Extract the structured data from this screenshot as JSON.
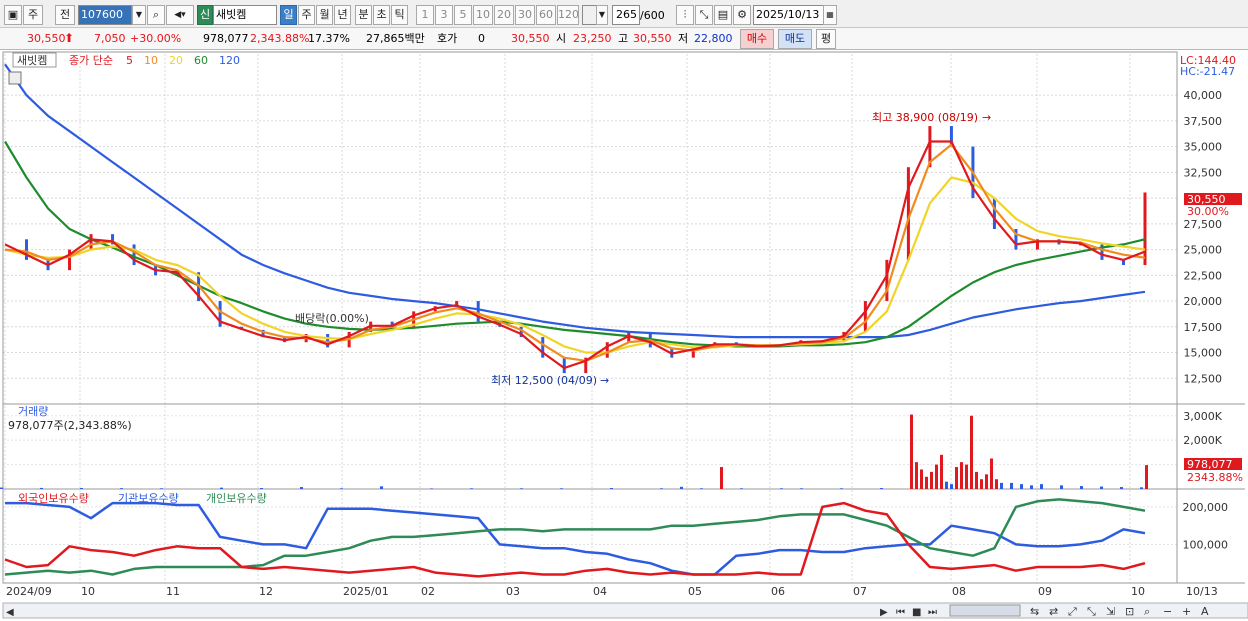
{
  "toolbar": {
    "tab_day": "주",
    "tab_prev": "전",
    "code": "107600",
    "stock_badge": "신",
    "name": "새빗켐",
    "periods": [
      "일",
      "주",
      "월",
      "년",
      "분",
      "초",
      "틱"
    ],
    "nums": [
      "1",
      "3",
      "5",
      "10",
      "20",
      "30",
      "60",
      "120"
    ],
    "count": "265",
    "count_total": "/600",
    "date": "2025/10/13"
  },
  "quote": {
    "price": "30,550",
    "change": "7,050",
    "rate": "+30.00%",
    "volume": "978,077",
    "vol_ratio": "2,343.88%",
    "turnover": "17.37%",
    "amount": "27,865백만",
    "hoga_label": "호가",
    "hoga": "0",
    "hoga_price": "30,550",
    "open_label": "시",
    "open": "23,250",
    "high_label": "고",
    "high": "30,550",
    "low_label": "저",
    "low": "22,800",
    "buy": "매수",
    "sell": "매도",
    "eval": "평"
  },
  "legend": {
    "name": "새빗켐",
    "ma_label": "종가 단순",
    "ma_periods": [
      "5",
      "10",
      "20",
      "60",
      "120"
    ],
    "ma_colors": [
      "#e0191f",
      "#f08c1e",
      "#f0d528",
      "#1e8c2d",
      "#2e5ce0"
    ]
  },
  "annotations": {
    "high": "최고 38,900 (08/19)",
    "low": "최저 12,500 (04/09)",
    "dividend": "배당락(0.00%)"
  },
  "scale": {
    "lc": "LC:144.40",
    "hc": "HC:-21.47",
    "price_tag": "30,550",
    "pct_tag": "30.00%",
    "vol_tag": "978,077",
    "vol_pct": "2343.88%"
  },
  "volume_panel": {
    "title": "거래량",
    "value": "978,077주(2,343.88%)"
  },
  "holding_panel": {
    "foreign": "외국인보유수량",
    "inst": "기관보유수량",
    "indiv": "개인보유수량",
    "colors": [
      "#e0191f",
      "#2e5ce0",
      "#2e8b57"
    ]
  },
  "chart_data": {
    "type": "line",
    "price_axis": {
      "min": 10000,
      "max": 45000,
      "ticks": [
        "12,500",
        "15,000",
        "17,500",
        "20,000",
        "22,500",
        "25,000",
        "27,500",
        "30,000",
        "32,500",
        "35,000",
        "37,500",
        "40,000"
      ]
    },
    "volume_axis": {
      "ticks": [
        "1,000K",
        "2,000K",
        "3,000K"
      ]
    },
    "holding_axis": {
      "ticks": [
        "100,000",
        "200,000"
      ]
    },
    "months": [
      "2024/09",
      "10",
      "11",
      "12",
      "2025/01",
      "02",
      "03",
      "04",
      "05",
      "06",
      "07",
      "08",
      "09",
      "10",
      "10/13"
    ],
    "x_index": [
      0,
      5,
      10,
      15,
      20,
      25,
      30,
      35,
      40,
      45,
      50,
      55,
      60,
      65,
      70,
      75,
      80,
      85,
      90,
      95,
      100,
      105,
      110,
      115,
      120,
      125,
      130,
      135,
      140,
      145,
      150,
      155,
      160,
      165,
      170,
      175,
      180,
      185,
      190,
      195,
      200,
      205,
      210,
      215,
      220,
      225,
      230,
      235,
      240,
      245,
      250,
      255,
      260,
      265
    ],
    "close": [
      26000,
      24000,
      23000,
      25000,
      26500,
      25500,
      23500,
      22500,
      22800,
      20000,
      17500,
      17200,
      16500,
      16000,
      16800,
      15500,
      17000,
      18000,
      17500,
      19000,
      19500,
      20000,
      18000,
      17500,
      16500,
      14500,
      13000,
      14500,
      16000,
      17000,
      15500,
      14500,
      15500,
      16000,
      15800,
      15500,
      15800,
      16200,
      16000,
      17000,
      20000,
      24000,
      33000,
      37000,
      35000,
      30000,
      27000,
      25000,
      26000,
      25500,
      25500,
      24000,
      23500,
      30550
    ],
    "ma5": [
      25500,
      24500,
      23500,
      24500,
      26000,
      25800,
      24000,
      23000,
      22800,
      20500,
      18000,
      17300,
      16600,
      16200,
      16500,
      15800,
      16600,
      17600,
      17600,
      18600,
      19300,
      19600,
      18500,
      17700,
      16800,
      15000,
      13500,
      14200,
      15600,
      16600,
      16000,
      14900,
      15300,
      15800,
      15800,
      15600,
      15700,
      16000,
      16100,
      16600,
      19000,
      22500,
      31000,
      35500,
      35500,
      31000,
      28000,
      25500,
      25800,
      25800,
      25600,
      24500,
      24000,
      24800
    ],
    "ma10": [
      25000,
      24800,
      24000,
      24300,
      25500,
      25800,
      24800,
      23500,
      23000,
      21500,
      19000,
      17800,
      17000,
      16500,
      16400,
      16000,
      16300,
      17200,
      17500,
      18200,
      18900,
      19300,
      18800,
      18000,
      17200,
      15800,
      14500,
      14200,
      15000,
      16000,
      16200,
      15400,
      15200,
      15600,
      15800,
      15700,
      15700,
      15900,
      16000,
      16400,
      18000,
      21000,
      28000,
      33500,
      35200,
      32500,
      29000,
      26500,
      25800,
      25800,
      25700,
      25000,
      24500,
      24200
    ],
    "ma20": [
      25000,
      24500,
      24200,
      24300,
      25000,
      25300,
      25000,
      24000,
      23500,
      22500,
      20500,
      18800,
      17800,
      17000,
      16600,
      16400,
      16300,
      16800,
      17200,
      17700,
      18300,
      18800,
      18700,
      18300,
      17700,
      16700,
      15600,
      15000,
      15000,
      15600,
      16000,
      15800,
      15500,
      15500,
      15700,
      15700,
      15700,
      15800,
      15900,
      16100,
      17000,
      19000,
      24000,
      29500,
      32000,
      31500,
      30000,
      28000,
      26800,
      26300,
      26000,
      25600,
      25300,
      25000
    ],
    "ma60": [
      35500,
      32000,
      29000,
      27000,
      26000,
      25200,
      24300,
      23500,
      22500,
      21500,
      20500,
      19800,
      19000,
      18300,
      17800,
      17500,
      17300,
      17200,
      17300,
      17400,
      17600,
      17800,
      17900,
      18000,
      17800,
      17500,
      17200,
      17000,
      16800,
      16600,
      16300,
      16000,
      15800,
      15700,
      15600,
      15600,
      15600,
      15700,
      15700,
      15800,
      16000,
      16500,
      17500,
      19000,
      20500,
      21800,
      22800,
      23500,
      24000,
      24400,
      24800,
      25200,
      25500,
      26000
    ],
    "ma120": [
      43000,
      40000,
      38000,
      36500,
      35000,
      33500,
      32000,
      30500,
      29000,
      27500,
      26000,
      24500,
      23500,
      22700,
      22000,
      21300,
      20800,
      20500,
      20200,
      20000,
      19800,
      19500,
      19200,
      18800,
      18400,
      18000,
      17700,
      17400,
      17200,
      17000,
      16900,
      16800,
      16700,
      16600,
      16500,
      16500,
      16500,
      16500,
      16500,
      16500,
      16500,
      16500,
      16700,
      17200,
      17800,
      18400,
      18800,
      19200,
      19500,
      19800,
      20000,
      20300,
      20600,
      20900
    ],
    "volume_k": [
      [
        0,
        60
      ],
      [
        40,
        45
      ],
      [
        80,
        40
      ],
      [
        120,
        35
      ],
      [
        160,
        30
      ],
      [
        220,
        55
      ],
      [
        260,
        40
      ],
      [
        300,
        80
      ],
      [
        340,
        30
      ],
      [
        380,
        110
      ],
      [
        430,
        25
      ],
      [
        470,
        30
      ],
      [
        520,
        30
      ],
      [
        560,
        30
      ],
      [
        610,
        40
      ],
      [
        660,
        30
      ],
      [
        680,
        90
      ],
      [
        700,
        30
      ],
      [
        720,
        900
      ],
      [
        740,
        30
      ],
      [
        780,
        30
      ],
      [
        800,
        30
      ],
      [
        840,
        30
      ],
      [
        880,
        40
      ],
      [
        910,
        3050
      ],
      [
        915,
        1100
      ],
      [
        920,
        800
      ],
      [
        925,
        500
      ],
      [
        930,
        700
      ],
      [
        935,
        1000
      ],
      [
        940,
        1400
      ],
      [
        945,
        300
      ],
      [
        950,
        200
      ],
      [
        955,
        900
      ],
      [
        960,
        1100
      ],
      [
        965,
        1000
      ],
      [
        970,
        3000
      ],
      [
        975,
        700
      ],
      [
        980,
        400
      ],
      [
        985,
        600
      ],
      [
        990,
        1250
      ],
      [
        995,
        400
      ],
      [
        1000,
        250
      ],
      [
        1010,
        250
      ],
      [
        1020,
        200
      ],
      [
        1030,
        150
      ],
      [
        1040,
        200
      ],
      [
        1060,
        150
      ],
      [
        1080,
        120
      ],
      [
        1100,
        100
      ],
      [
        1120,
        80
      ],
      [
        1140,
        70
      ],
      [
        1145,
        978
      ]
    ],
    "foreign": [
      60000,
      40000,
      45000,
      95000,
      85000,
      80000,
      70000,
      85000,
      95000,
      90000,
      90000,
      40000,
      35000,
      40000,
      35000,
      30000,
      25000,
      30000,
      35000,
      40000,
      25000,
      20000,
      15000,
      20000,
      25000,
      20000,
      20000,
      30000,
      35000,
      25000,
      20000,
      25000,
      20000,
      20000,
      20000,
      25000,
      20000,
      20000,
      200000,
      210000,
      190000,
      180000,
      100000,
      40000,
      35000,
      40000,
      45000,
      30000,
      40000,
      40000,
      40000,
      45000,
      35000,
      50000
    ],
    "inst": [
      210000,
      210000,
      205000,
      200000,
      170000,
      210000,
      210000,
      210000,
      205000,
      205000,
      120000,
      110000,
      100000,
      100000,
      90000,
      195000,
      195000,
      195000,
      190000,
      185000,
      180000,
      175000,
      170000,
      100000,
      95000,
      90000,
      90000,
      80000,
      75000,
      60000,
      50000,
      30000,
      20000,
      20000,
      70000,
      75000,
      85000,
      85000,
      80000,
      80000,
      90000,
      95000,
      100000,
      100000,
      150000,
      140000,
      130000,
      100000,
      95000,
      95000,
      100000,
      110000,
      140000,
      130000
    ],
    "indiv": [
      20000,
      25000,
      30000,
      25000,
      30000,
      20000,
      35000,
      40000,
      40000,
      40000,
      40000,
      40000,
      45000,
      70000,
      70000,
      80000,
      90000,
      110000,
      120000,
      120000,
      125000,
      130000,
      135000,
      140000,
      140000,
      135000,
      140000,
      140000,
      140000,
      140000,
      140000,
      150000,
      150000,
      155000,
      160000,
      165000,
      175000,
      180000,
      180000,
      180000,
      165000,
      150000,
      120000,
      90000,
      80000,
      70000,
      90000,
      200000,
      215000,
      220000,
      215000,
      210000,
      200000,
      190000
    ]
  }
}
